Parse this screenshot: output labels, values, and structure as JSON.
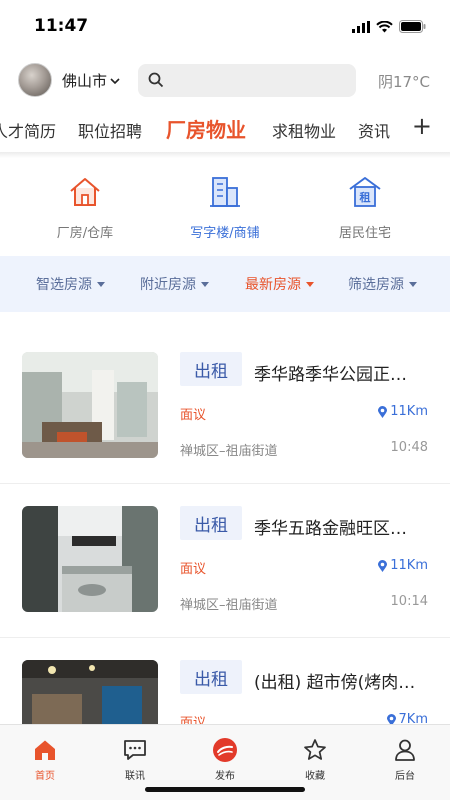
{
  "status_bar": {
    "time": "11:47"
  },
  "header": {
    "city": "佛山市",
    "weather": "阴17°C"
  },
  "top_tabs": [
    {
      "label": "人才简历",
      "active": false
    },
    {
      "label": "职位招聘",
      "active": false
    },
    {
      "label": "厂房物业",
      "active": true
    },
    {
      "label": "求租物业",
      "active": false
    },
    {
      "label": "资讯",
      "active": false
    }
  ],
  "top_tabs_more": "+",
  "categories": [
    {
      "label": "厂房/仓库",
      "icon": "house-icon",
      "active": false
    },
    {
      "label": "写字楼/商铺",
      "icon": "office-building-icon",
      "active": true
    },
    {
      "label": "居民住宅",
      "icon": "rent-house-icon",
      "active": false,
      "icon_text": "租"
    }
  ],
  "filters": [
    {
      "label": "智选房源",
      "active": false
    },
    {
      "label": "附近房源",
      "active": false
    },
    {
      "label": "最新房源",
      "active": true
    },
    {
      "label": "筛选房源",
      "active": false
    }
  ],
  "listings": [
    {
      "badge": "出租",
      "title": "季华路季华公园正…",
      "price": "面议",
      "distance": "11Km",
      "location": "禅城区–祖庙街道",
      "time": "10:48"
    },
    {
      "badge": "出租",
      "title": "季华五路金融旺区…",
      "price": "面议",
      "distance": "11Km",
      "location": "禅城区–祖庙街道",
      "time": "10:14"
    },
    {
      "badge": "出租",
      "title": "(出租) 超市傍(烤肉…",
      "price": "面议",
      "distance": "7Km",
      "location": "",
      "time": ""
    }
  ],
  "bottom_nav": [
    {
      "label": "首页",
      "icon": "home-icon",
      "active": true
    },
    {
      "label": "联讯",
      "icon": "chat-icon",
      "active": false
    },
    {
      "label": "发布",
      "icon": "publish-icon",
      "active": false
    },
    {
      "label": "收藏",
      "icon": "star-icon",
      "active": false
    },
    {
      "label": "后台",
      "icon": "user-icon",
      "active": false
    }
  ],
  "colors": {
    "accent": "#e8542c",
    "blue": "#3a6fd8",
    "filter_bg": "#eef3fd"
  }
}
